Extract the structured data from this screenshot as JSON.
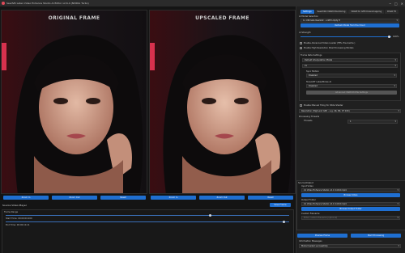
{
  "window": {
    "title": "SeedVR Latex Video Enhance Studio AI Editor v2.6.4 (NVIDIA Turbo)",
    "min": "─",
    "max": "□",
    "close": "✕"
  },
  "frames": {
    "original_title": "ORIGINAL FRAME",
    "upscaled_title": "UPSCALED FRAME"
  },
  "left_buttons": {
    "row1": [
      "Zoom In",
      "Zoom Out",
      "Reset"
    ],
    "row2": [
      "Zoom In",
      "Zoom Out",
      "Reset"
    ]
  },
  "video_player": {
    "label": "Source Video Player",
    "save_button": "Save Frame",
    "group_label": "Frame Range",
    "start_label": "Start Time: 00:00:00.000",
    "end_label": "End Time: 00:00:10.11",
    "start_fraction": 0.72,
    "end_fraction": 0.98
  },
  "tabs": [
    "Settings",
    "SeedVR2 VRAM Monitoring",
    "VRAM for GFN Downmapping",
    "DSLR FX"
  ],
  "settings": {
    "ai_model_label": "AI Model Selection",
    "ai_model_value": "1x Ultimate Realistic - untflm Opty H",
    "refresh_models": "Refresh Model from the Cloud",
    "ai_strength_label": "AI Strength",
    "ai_strength_value": "100%",
    "ai_strength_fraction": 0.98,
    "cb_advanced": "Enable Advanced Video Loader (FPS, Pre-Cache )",
    "cb_highres": "Enable High Resolution Pixel Processing Models",
    "frame_rate_group": "Frame Rate Settings",
    "frame_rate_value": "Default Interpolation Model",
    "frame_rate_mult": "2x",
    "sync_label": "Sync Motion",
    "sync_value": "Disabled",
    "tensor_label": "TensorRT Latex/Noise AI",
    "tensor_value": "Disabled",
    "tensor_button": "Advanced VRAM Profile Settings",
    "cb_manual": "Enable Manual Tiling for Wide Shader",
    "resolution_value": "Resolution (High-end GPU - e.g. 4K, 8K, 4T 10K)",
    "processing_label": "Processing Threads",
    "threads_label": "Threads",
    "threads_value": "1",
    "source_output": "Source/Output",
    "input_video_label": "Input Video",
    "input_video_value": "2x Video Enhance Studio v2.1 Unfold.mp4",
    "browse_video": "Browse Video",
    "output_folder_label": "Output Folder",
    "output_folder_value": "2x Video Enhance Studio v2.1 Unfold.mp4",
    "browse_output": "Browse Output Folder",
    "filename_label": "Custom Filename",
    "filename_placeholder": "Enter custom filename (optional)",
    "preview_button": "Preview Frame",
    "start_button": "Start Processing",
    "info_label": "Information Messages",
    "info_text": "Model loaded successfully"
  }
}
